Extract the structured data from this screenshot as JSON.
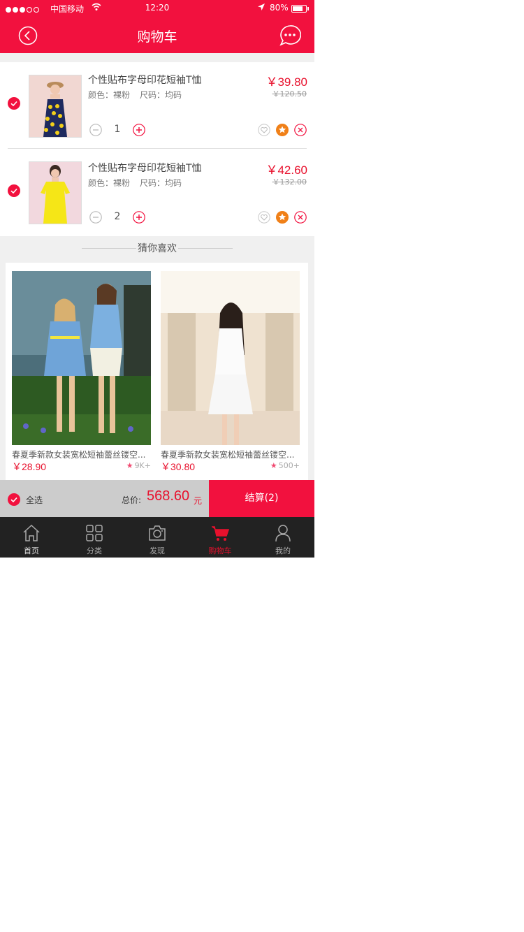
{
  "status_bar": {
    "carrier": "中国移动",
    "time": "12:20",
    "battery": "80%",
    "battery_level": 0.8
  },
  "header": {
    "title": "购物车"
  },
  "cart": {
    "items": [
      {
        "name": "个性贴布字母印花短袖T恤",
        "color_label": "颜色：裸粉",
        "size_label": "尺码：均码",
        "price": "￥39.80",
        "original_price": "￥120.50",
        "quantity": "1"
      },
      {
        "name": "个性贴布字母印花短袖T恤",
        "color_label": "颜色：裸粉",
        "size_label": "尺码：均码",
        "price": "￥42.60",
        "original_price": "￥132.00",
        "quantity": "2"
      }
    ]
  },
  "recommend": {
    "title": "猜你喜欢",
    "items": [
      {
        "name": "春夏季新款女装宽松短袖蕾丝镂空...",
        "price": "￥28.90",
        "sales": "9K+"
      },
      {
        "name": "春夏季新款女装宽松短袖蕾丝镂空...",
        "price": "￥30.80",
        "sales": "500+"
      }
    ]
  },
  "checkout": {
    "select_all": "全选",
    "total_label": "总价:",
    "total": "568.60",
    "unit": "元",
    "button": "结算(2)"
  },
  "tabbar": {
    "tabs": [
      {
        "label": "首页",
        "icon": "home-icon"
      },
      {
        "label": "分类",
        "icon": "category-icon"
      },
      {
        "label": "发现",
        "icon": "camera-icon"
      },
      {
        "label": "购物车",
        "icon": "cart-icon"
      },
      {
        "label": "我的",
        "icon": "user-icon"
      }
    ],
    "active": 3
  },
  "colors": {
    "brand": "#f2113e",
    "price": "#e8112d",
    "star": "#f08018",
    "tabbar": "#222222"
  }
}
